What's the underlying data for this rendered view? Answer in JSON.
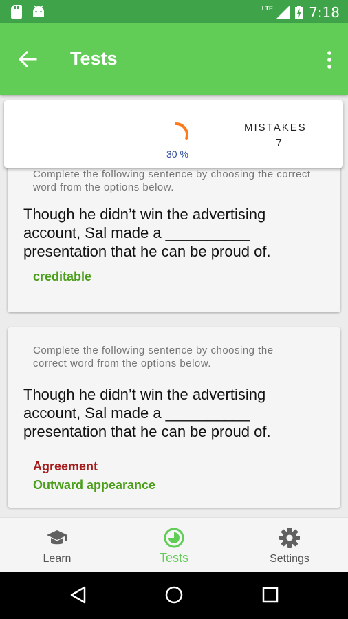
{
  "status_bar": {
    "time": "7:18",
    "network_label": "LTE",
    "icons": [
      "sd-card-icon",
      "android-icon",
      "signal-icon",
      "battery-charging-icon"
    ]
  },
  "app_bar": {
    "title": "Tests",
    "icons": [
      "back-arrow-icon",
      "more-vert-icon"
    ]
  },
  "score": {
    "progress_percent": 30,
    "percent_label": "30 %",
    "mistakes_label": "MISTAKES",
    "mistakes_value": "7"
  },
  "questions": [
    {
      "instruction": "Complete the following sentence by choosing the correct word from the options below.",
      "sentence_lines": [
        "Though he didn’t win the advertising",
        "account, Sal made a __________",
        "presentation that he can be proud of."
      ],
      "answers": [
        {
          "text": "creditable",
          "status": "correct"
        }
      ]
    },
    {
      "instruction_lines": [
        "Complete the following sentence by choosing the",
        "correct word from the options below."
      ],
      "sentence_lines": [
        "Though he didn’t win the advertising",
        "account, Sal made a __________",
        "presentation that he can be proud of."
      ],
      "answers": [
        {
          "text": "Agreement",
          "status": "wrong"
        },
        {
          "text": "Outward appearance",
          "status": "correct"
        }
      ]
    }
  ],
  "bottom_nav": {
    "items": [
      {
        "label": "Learn",
        "icon": "graduation-cap-icon",
        "active": false
      },
      {
        "label": "Tests",
        "icon": "timer-icon",
        "active": true
      },
      {
        "label": "Settings",
        "icon": "gear-icon",
        "active": false
      }
    ]
  },
  "colors": {
    "status_bar": "#3fa34a",
    "app_bar": "#61cc56",
    "correct": "#4a9e1a",
    "wrong": "#a51a1a",
    "gauge": "#ff7a1a",
    "percent_text": "#2b4c9b"
  }
}
